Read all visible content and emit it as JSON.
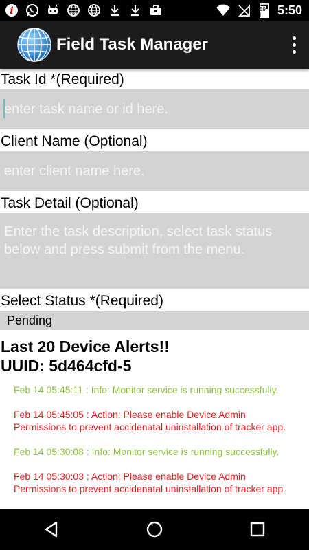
{
  "status_bar": {
    "time": "5:50",
    "left_icons": [
      "info-icon",
      "whatsapp-icon",
      "android-icon",
      "globe-icon",
      "globe-icon",
      "download-icon",
      "download-icon",
      "briefcase-icon"
    ],
    "right_icons": [
      "wifi-icon",
      "no-sim-icon",
      "battery-icon"
    ],
    "battery_level": "59"
  },
  "app_bar": {
    "title": "Field Task Manager",
    "logo": "globe-logo-icon",
    "menu_icon": "overflow-menu-icon"
  },
  "form": {
    "task_id_label": "Task Id *(Required)",
    "task_id_placeholder": "enter task name or id here.",
    "client_name_label": "Client Name (Optional)",
    "client_name_placeholder": "enter client name here.",
    "task_detail_label": "Task Detail (Optional)",
    "task_detail_placeholder": "Enter the task description, select task status below and press submit from the menu.",
    "status_label": "Select Status *(Required)",
    "status_value": "Pending"
  },
  "alerts": {
    "heading_line1": "Last 20 Device Alerts!!",
    "heading_line2": "UUID: 5d464cfd-5",
    "items": [
      {
        "type": "info",
        "text": "Feb 14 05:45:11 : Info: Monitor service is running successfully."
      },
      {
        "type": "action",
        "text": "Feb 14 05:45:05 : Action: Please enable Device Admin Permissions to prevent accidenatal uninstallation of tracker app."
      },
      {
        "type": "info",
        "text": "Feb 14 05:30:08 : Info: Monitor service is running successfully."
      },
      {
        "type": "action",
        "text": "Feb 14 05:30:03 : Action: Please enable Device Admin Permissions to prevent accidenatal uninstallation of tracker app."
      }
    ]
  },
  "nav_bar": {
    "back": "back-icon",
    "home": "home-icon",
    "recents": "recents-icon"
  },
  "colors": {
    "info": "#8dc63f",
    "action": "#ee1c1c",
    "field_bg": "#d3d3d3",
    "app_bar": "#1c1c1c"
  }
}
